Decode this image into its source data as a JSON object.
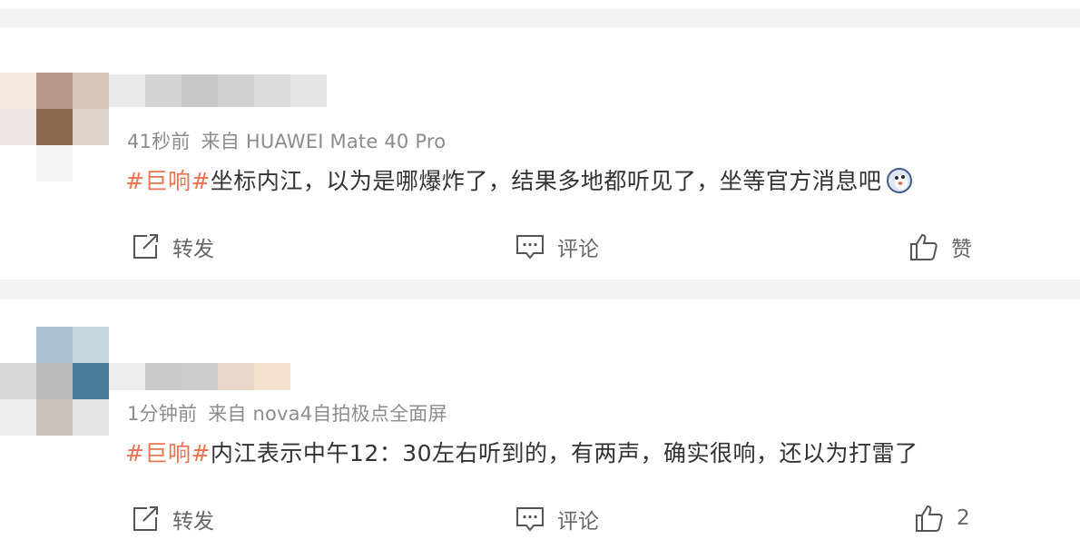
{
  "posts": [
    {
      "time": "41秒前",
      "source_prefix": "来自",
      "source": "HUAWEI Mate 40 Pro",
      "tag": "#巨响#",
      "text": "坐标内江，以为是哪爆炸了，结果多地都听见了，坐等官方消息吧",
      "emoji": "doge-emoji-icon",
      "actions": {
        "repost": "转发",
        "comment": "评论",
        "like": "赞"
      }
    },
    {
      "time": "1分钟前",
      "source_prefix": "来自",
      "source": "nova4自拍极点全面屏",
      "tag": "#巨响#",
      "text": "内江表示中午12：30左右听到的，有两声，确实很响，还以为打雷了",
      "actions": {
        "repost": "转发",
        "comment": "评论",
        "like": "2"
      }
    }
  ],
  "colors": {
    "tag": "#eb7350",
    "text": "#333333",
    "meta": "#8c8c8c",
    "action": "#666666",
    "background": "#f2f2f2"
  }
}
